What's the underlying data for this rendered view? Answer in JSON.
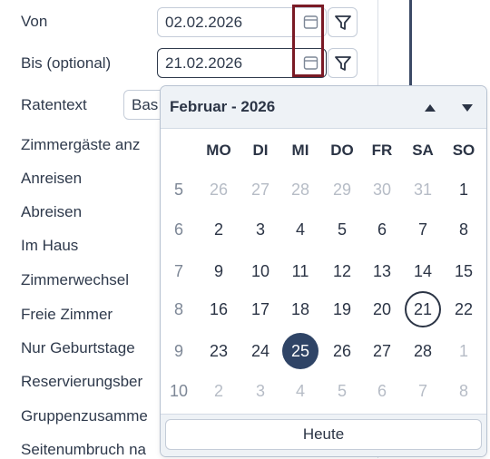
{
  "form": {
    "von_label": "Von",
    "von_value": "02.02.2026",
    "bis_label": "Bis (optional)",
    "bis_value": "21.02.2026",
    "ratentext_label": "Ratentext",
    "ratentext_value": "Bas",
    "options": [
      "Zimmergäste anz",
      "Anreisen",
      "Abreisen",
      "Im Haus",
      "Zimmerwechsel",
      "Freie Zimmer",
      "Nur Geburtstage",
      "Reservierungsber",
      "Gruppenzusamme",
      "Seitenumbruch na"
    ]
  },
  "calendar": {
    "title": "Februar - 2026",
    "weekdays": [
      "MO",
      "DI",
      "MI",
      "DO",
      "FR",
      "SA",
      "SO"
    ],
    "weeks": [
      {
        "wk": "5",
        "days": [
          "26",
          "27",
          "28",
          "29",
          "30",
          "31",
          "1"
        ],
        "other": [
          1,
          1,
          1,
          1,
          1,
          1,
          0
        ]
      },
      {
        "wk": "6",
        "days": [
          "2",
          "3",
          "4",
          "5",
          "6",
          "7",
          "8"
        ],
        "other": [
          0,
          0,
          0,
          0,
          0,
          0,
          0
        ]
      },
      {
        "wk": "7",
        "days": [
          "9",
          "10",
          "11",
          "12",
          "13",
          "14",
          "15"
        ],
        "other": [
          0,
          0,
          0,
          0,
          0,
          0,
          0
        ]
      },
      {
        "wk": "8",
        "days": [
          "16",
          "17",
          "18",
          "19",
          "20",
          "21",
          "22"
        ],
        "other": [
          0,
          0,
          0,
          0,
          0,
          0,
          0
        ]
      },
      {
        "wk": "9",
        "days": [
          "23",
          "24",
          "25",
          "26",
          "27",
          "28",
          "1"
        ],
        "other": [
          0,
          0,
          0,
          0,
          0,
          0,
          1
        ]
      },
      {
        "wk": "10",
        "days": [
          "2",
          "3",
          "4",
          "5",
          "6",
          "7",
          "8"
        ],
        "other": [
          1,
          1,
          1,
          1,
          1,
          1,
          1
        ]
      }
    ],
    "today_day": "21",
    "selected_day": "25",
    "footer_button": "Heute",
    "colors": {
      "selected": "#2f4466",
      "other_month": "#b6bcc6",
      "highlight_border": "#7a1a25"
    }
  },
  "icons": {
    "calendar": "calendar-icon",
    "filter": "filter-icon",
    "prev": "triangle-up-icon",
    "next": "triangle-down-icon"
  }
}
